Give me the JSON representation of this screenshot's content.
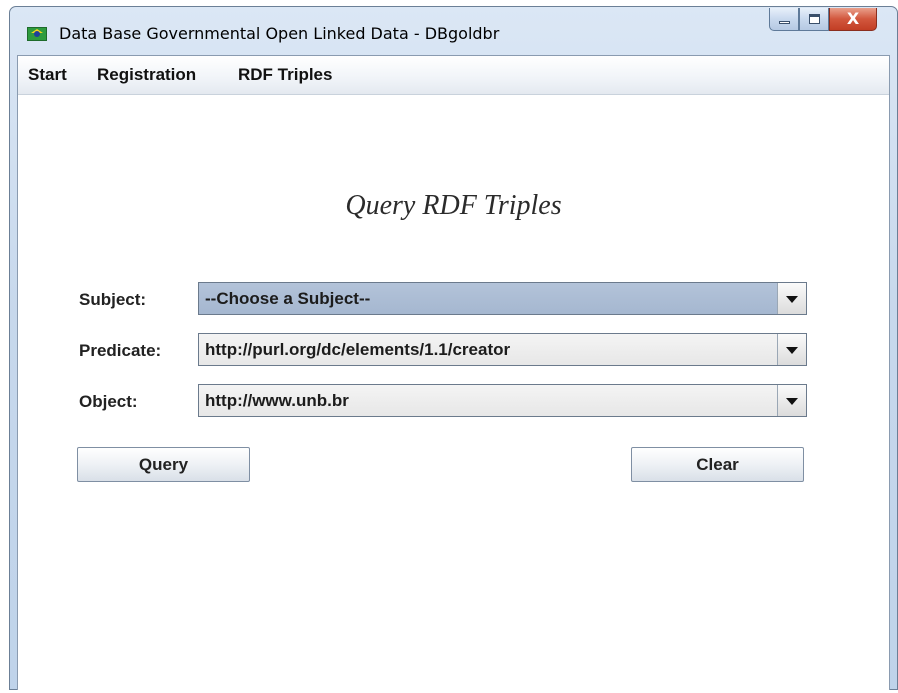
{
  "window": {
    "title": "Data Base Governmental Open Linked Data - DBgoldbr",
    "icon": "brazil-flag-icon",
    "close_glyph": "X"
  },
  "menu": {
    "items": [
      {
        "label": "Start"
      },
      {
        "label": "Registration"
      },
      {
        "label": "RDF Triples"
      }
    ]
  },
  "form": {
    "title": "Query RDF Triples",
    "subject": {
      "label": "Subject:",
      "value": "--Choose a Subject--"
    },
    "predicate": {
      "label": "Predicate:",
      "value": "http://purl.org/dc/elements/1.1/creator"
    },
    "object": {
      "label": "Object:",
      "value": "http://www.unb.br"
    }
  },
  "buttons": {
    "query": "Query",
    "clear": "Clear"
  }
}
